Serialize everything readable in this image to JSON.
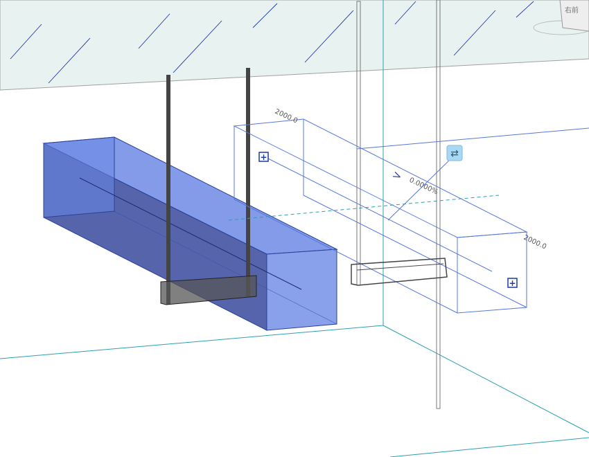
{
  "viewport": {
    "background": "#ffffff",
    "ceiling_fill": "#e8f3f1",
    "ceiling_hatch_color": "#2233aa",
    "grid_line_color": "#2aa0b0",
    "duct_fill": "#3f5fd0",
    "duct_edge_color": "#2a3f9a",
    "selection_color": "#5577dd",
    "hanger_color": "#444444"
  },
  "annotations": {
    "width_dim_top": "2000.0",
    "width_dim_right": "2000.0",
    "slope_value": "0.0000%",
    "slope_arrow_glyph": ">",
    "flip_icon_glyph": "⇄"
  },
  "icons": {
    "connector_glyph": "+",
    "view_cube_label": "右前"
  }
}
